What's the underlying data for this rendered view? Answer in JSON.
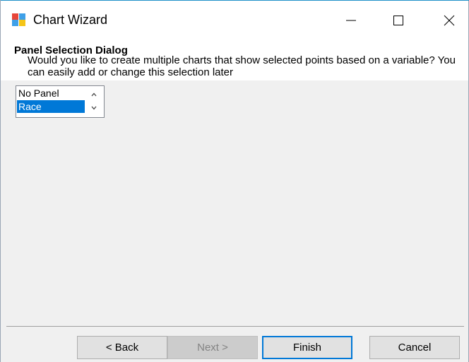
{
  "window": {
    "title": "Chart Wizard",
    "icon": "chart-wizard-app-icon",
    "controls": {
      "minimize_icon": "minimize-icon",
      "maximize_icon": "maximize-icon",
      "close_icon": "close-icon"
    }
  },
  "header": {
    "title": "Panel Selection Dialog",
    "description": "Would you like to create multiple charts that show selected points based on a variable?  You can easily add or change this selection later"
  },
  "panel_list": {
    "items": [
      {
        "label": "No Panel",
        "selected": false
      },
      {
        "label": "Race",
        "selected": true
      }
    ],
    "scroll_up_icon": "chevron-up-icon",
    "scroll_down_icon": "chevron-down-icon"
  },
  "buttons": {
    "back": "< Back",
    "next": "Next >",
    "finish": "Finish",
    "cancel": "Cancel"
  },
  "colors": {
    "accent": "#0078d7",
    "title_bar": "#ffffff",
    "dialog_background": "#f0f0f0",
    "disabled_text": "#838383"
  }
}
